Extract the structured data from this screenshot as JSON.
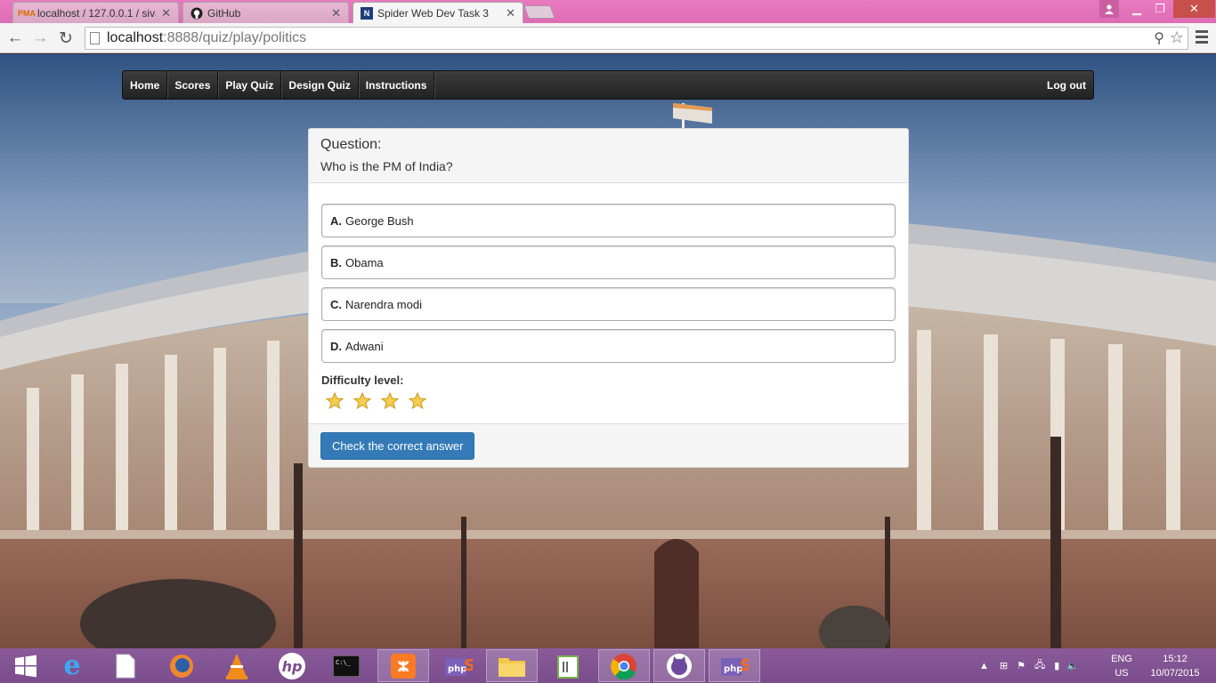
{
  "browser": {
    "tabs": [
      {
        "title": "localhost / 127.0.0.1 / siva",
        "favicon": "PMA",
        "active": false
      },
      {
        "title": "GitHub",
        "favicon": "github-icon",
        "active": false
      },
      {
        "title": "Spider Web Dev Task 3",
        "favicon": "N",
        "active": true
      }
    ],
    "url_host": "localhost",
    "url_path": ":8888/quiz/play/politics"
  },
  "nav": {
    "items": [
      "Home",
      "Scores",
      "Play Quiz",
      "Design Quiz",
      "Instructions"
    ],
    "logout": "Log out"
  },
  "question": {
    "label": "Question:",
    "text": "Who is the PM of India?",
    "options": [
      {
        "letter": "A.",
        "text": "George Bush"
      },
      {
        "letter": "B.",
        "text": "Obama"
      },
      {
        "letter": "C.",
        "text": "Narendra modi"
      },
      {
        "letter": "D.",
        "text": "Adwani"
      }
    ],
    "difficulty_label": "Difficulty level:",
    "difficulty_stars": 4,
    "check_button": "Check the correct answer"
  },
  "taskbar": {
    "lang": "ENG",
    "region": "US",
    "time": "15:12",
    "date": "10/07/2015",
    "colors": {
      "accent": "#7b4d8c",
      "button": "#337ab7"
    }
  }
}
